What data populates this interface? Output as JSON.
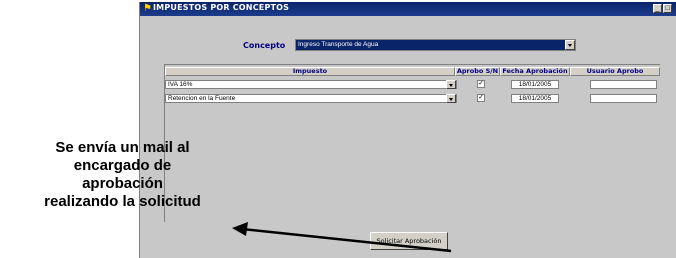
{
  "window": {
    "title": "IMPUESTOS POR CONCEPTOS",
    "minimize_symbol": "_",
    "maximize_symbol": "□"
  },
  "concept": {
    "label": "Concepto",
    "value": "Ingreso Transporte de Agua"
  },
  "table": {
    "columns": [
      "Impuesto",
      "Aprobo S/N",
      "Fecha Aprobación",
      "Usuario Aprobo"
    ],
    "rows": [
      {
        "impuesto": "IVA 16%",
        "aprobo": true,
        "fecha": "18/01/2005",
        "usuario": ""
      },
      {
        "impuesto": "Retencion en la Fuente",
        "aprobo": true,
        "fecha": "18/01/2005",
        "usuario": ""
      }
    ]
  },
  "button_label": "Solicitar Aprobación",
  "check_mark": "✓",
  "annotation": {
    "lines": [
      "Se envía un mail al",
      "encargado de",
      "aprobación",
      "realizando la solicitud"
    ]
  },
  "colors": {
    "titlebar": "#0a246a",
    "window_bg": "#c8c8c8",
    "label_blue": "#000080"
  }
}
